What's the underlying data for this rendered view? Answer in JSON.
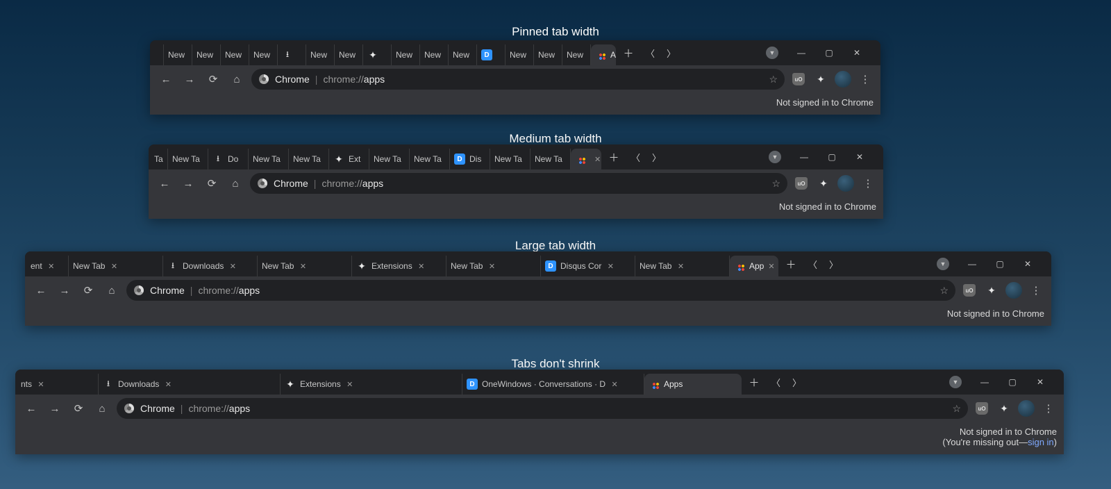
{
  "captions": {
    "c1": "Pinned tab width",
    "c2": "Medium tab width",
    "c3": "Large tab width",
    "c4": "Tabs don't shrink"
  },
  "omni": {
    "label": "Chrome",
    "prefix": "chrome://",
    "path": "apps"
  },
  "status": {
    "not_signed": "Not signed in to Chrome",
    "missing_pre": "(You're missing out—",
    "signin": "sign in",
    "missing_post": ")"
  },
  "windows": [
    {
      "id": "w1",
      "tabs": [
        {
          "label": "",
          "icon": null,
          "partial": true
        },
        {
          "label": "New"
        },
        {
          "label": "New"
        },
        {
          "label": "New"
        },
        {
          "label": "New"
        },
        {
          "label": "",
          "icon": "download"
        },
        {
          "label": "New"
        },
        {
          "label": "New"
        },
        {
          "label": "",
          "icon": "puzzle"
        },
        {
          "label": "New"
        },
        {
          "label": "New"
        },
        {
          "label": "New"
        },
        {
          "label": "",
          "icon": "disqus"
        },
        {
          "label": "New"
        },
        {
          "label": "New"
        },
        {
          "label": "New"
        },
        {
          "label": "A",
          "icon": "apps",
          "active": true,
          "close": true
        }
      ]
    },
    {
      "id": "w2",
      "tabs": [
        {
          "label": "Ta",
          "partial": true
        },
        {
          "label": "New Ta"
        },
        {
          "label": "Do",
          "icon": "download"
        },
        {
          "label": "New Ta"
        },
        {
          "label": "New Ta"
        },
        {
          "label": "Ext",
          "icon": "puzzle"
        },
        {
          "label": "New Ta"
        },
        {
          "label": "New Ta"
        },
        {
          "label": "Dis",
          "icon": "disqus"
        },
        {
          "label": "New Ta"
        },
        {
          "label": "New Ta"
        },
        {
          "label": "",
          "icon": "apps",
          "active": true,
          "close": true
        }
      ]
    },
    {
      "id": "w3",
      "tabs": [
        {
          "label": "ent",
          "close": true,
          "partial": true
        },
        {
          "label": "New Tab",
          "close": true
        },
        {
          "label": "Downloads",
          "icon": "download",
          "close": true
        },
        {
          "label": "New Tab",
          "close": true
        },
        {
          "label": "Extensions",
          "icon": "puzzle",
          "close": true
        },
        {
          "label": "New Tab",
          "close": true
        },
        {
          "label": "Disqus Cor",
          "icon": "disqus",
          "close": true
        },
        {
          "label": "New Tab",
          "close": true
        },
        {
          "label": "App",
          "icon": "apps",
          "active": true,
          "close": true
        }
      ]
    },
    {
      "id": "w4",
      "show_missing": true,
      "tabs": [
        {
          "label": "nts",
          "close": true,
          "partial": true
        },
        {
          "label": "Downloads",
          "icon": "download",
          "close": true
        },
        {
          "label": "Extensions",
          "icon": "puzzle",
          "close": true
        },
        {
          "label": "OneWindows · Conversations · D",
          "icon": "disqus",
          "close": true
        },
        {
          "label": "Apps",
          "icon": "apps",
          "active": true
        }
      ]
    }
  ]
}
